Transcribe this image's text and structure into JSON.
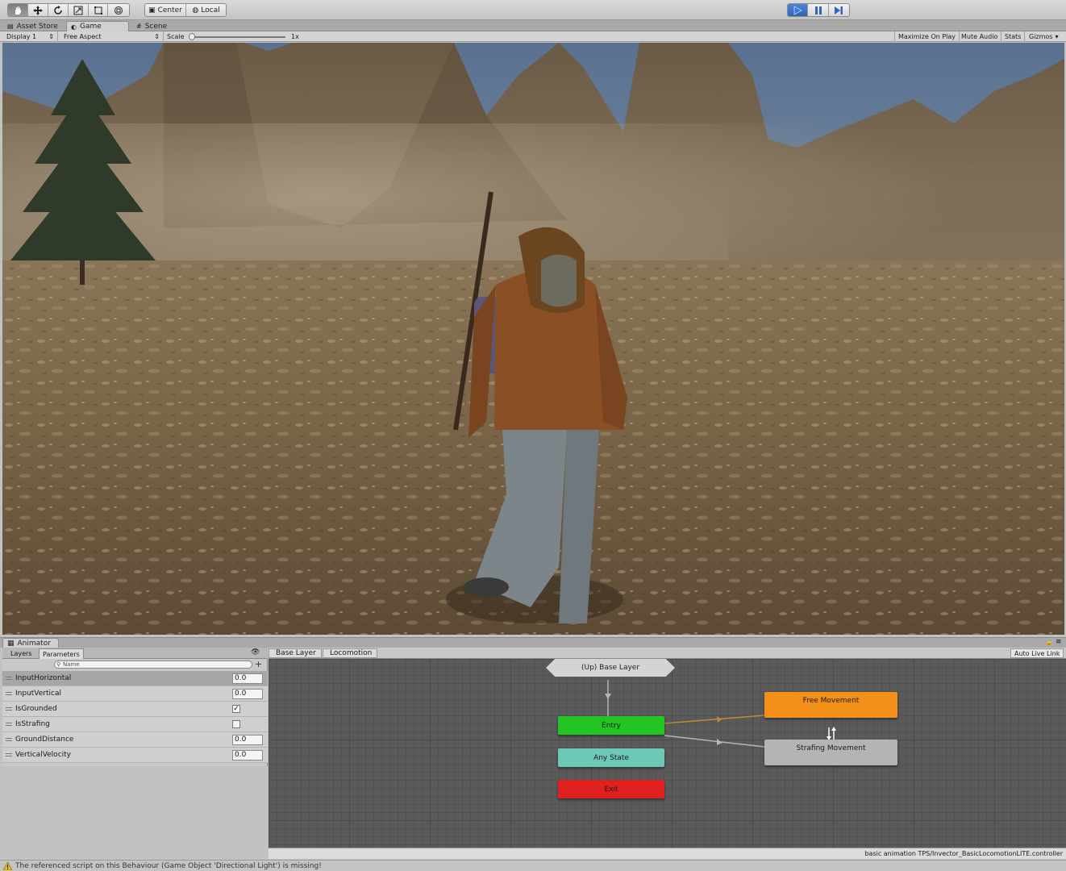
{
  "toolbar": {
    "tools": [
      "hand-tool-icon",
      "move-tool-icon",
      "rotate-tool-icon",
      "scale-tool-icon",
      "rect-tool-icon",
      "transform-tool-icon"
    ],
    "pivot_center": "Center",
    "pivot_local": "Local",
    "play_icons": [
      "play-icon",
      "pause-icon",
      "step-icon"
    ]
  },
  "tabs": {
    "asset_store": "Asset Store",
    "game": "Game",
    "scene": "Scene"
  },
  "game_bar": {
    "display": "Display 1",
    "aspect": "Free Aspect",
    "scale_label": "Scale",
    "scale_value": "1x",
    "maximize": "Maximize On Play",
    "mute": "Mute Audio",
    "stats": "Stats",
    "gizmos": "Gizmos"
  },
  "animator": {
    "title": "Animator",
    "tab_layers": "Layers",
    "tab_parameters": "Parameters",
    "search_placeholder": "Name",
    "parameters": [
      {
        "name": "InputHorizontal",
        "type": "float",
        "value": "0.0"
      },
      {
        "name": "InputVertical",
        "type": "float",
        "value": "0.0"
      },
      {
        "name": "IsGrounded",
        "type": "bool",
        "value": "✓"
      },
      {
        "name": "IsStrafing",
        "type": "bool",
        "value": ""
      },
      {
        "name": "GroundDistance",
        "type": "float",
        "value": "0.0"
      },
      {
        "name": "VerticalVelocity",
        "type": "float",
        "value": "0.0"
      }
    ],
    "breadcrumbs": [
      "Base Layer",
      "Locomotion"
    ],
    "auto_live_link": "Auto Live Link",
    "nodes": {
      "up": "(Up) Base Layer",
      "entry": "Entry",
      "any_state": "Any State",
      "exit": "Exit",
      "free_movement": "Free Movement",
      "strafing_movement": "Strafing Movement"
    },
    "colors": {
      "entry": "#23c523",
      "any_state": "#6ec8b8",
      "exit": "#e01f1f",
      "free_movement": "#f39019",
      "strafing_movement": "#b4b4b4"
    },
    "controller_path": "basic animation TPS/Invector_BasicLocomotionLITE.controller"
  },
  "status": {
    "message": "The referenced script on this Behaviour (Game Object 'Directional Light') is missing!"
  }
}
